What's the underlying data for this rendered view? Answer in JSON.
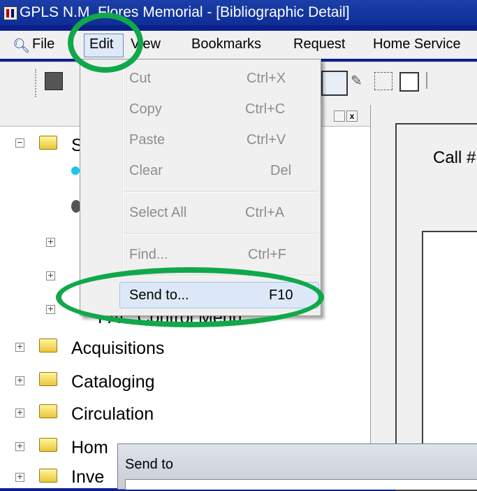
{
  "window": {
    "title": "GPLS N.M. Flores Memorial - [Bibliographic Detail]"
  },
  "menubar": {
    "items": [
      "File",
      "Edit",
      "View",
      "Bookmarks",
      "Request",
      "Home Service"
    ]
  },
  "edit_menu": {
    "items": [
      {
        "label": "Cut",
        "shortcut": "Ctrl+X",
        "enabled": false
      },
      {
        "label": "Copy",
        "shortcut": "Ctrl+C",
        "enabled": false
      },
      {
        "label": "Paste",
        "shortcut": "Ctrl+V",
        "enabled": false
      },
      {
        "label": "Clear",
        "shortcut": "Del",
        "enabled": false
      },
      {
        "label": "Select All",
        "shortcut": "Ctrl+A",
        "enabled": false
      },
      {
        "label": "Find...",
        "shortcut": "Ctrl+F",
        "enabled": false
      },
      {
        "label": "Send to...",
        "shortcut": "F10",
        "enabled": true,
        "highlighted": true
      }
    ]
  },
  "tree": {
    "partial_items": [
      "S",
      "PAC Control Menu"
    ],
    "items": [
      "Acquisitions",
      "Cataloging",
      "Circulation",
      "Hom",
      "Inve"
    ]
  },
  "right_panel": {
    "label": "Call #"
  },
  "dialog": {
    "title": "Send to"
  },
  "colors": {
    "background": "#0b1f8c",
    "annotation": "#10a84a",
    "menu_highlight": "#dce8f8"
  }
}
